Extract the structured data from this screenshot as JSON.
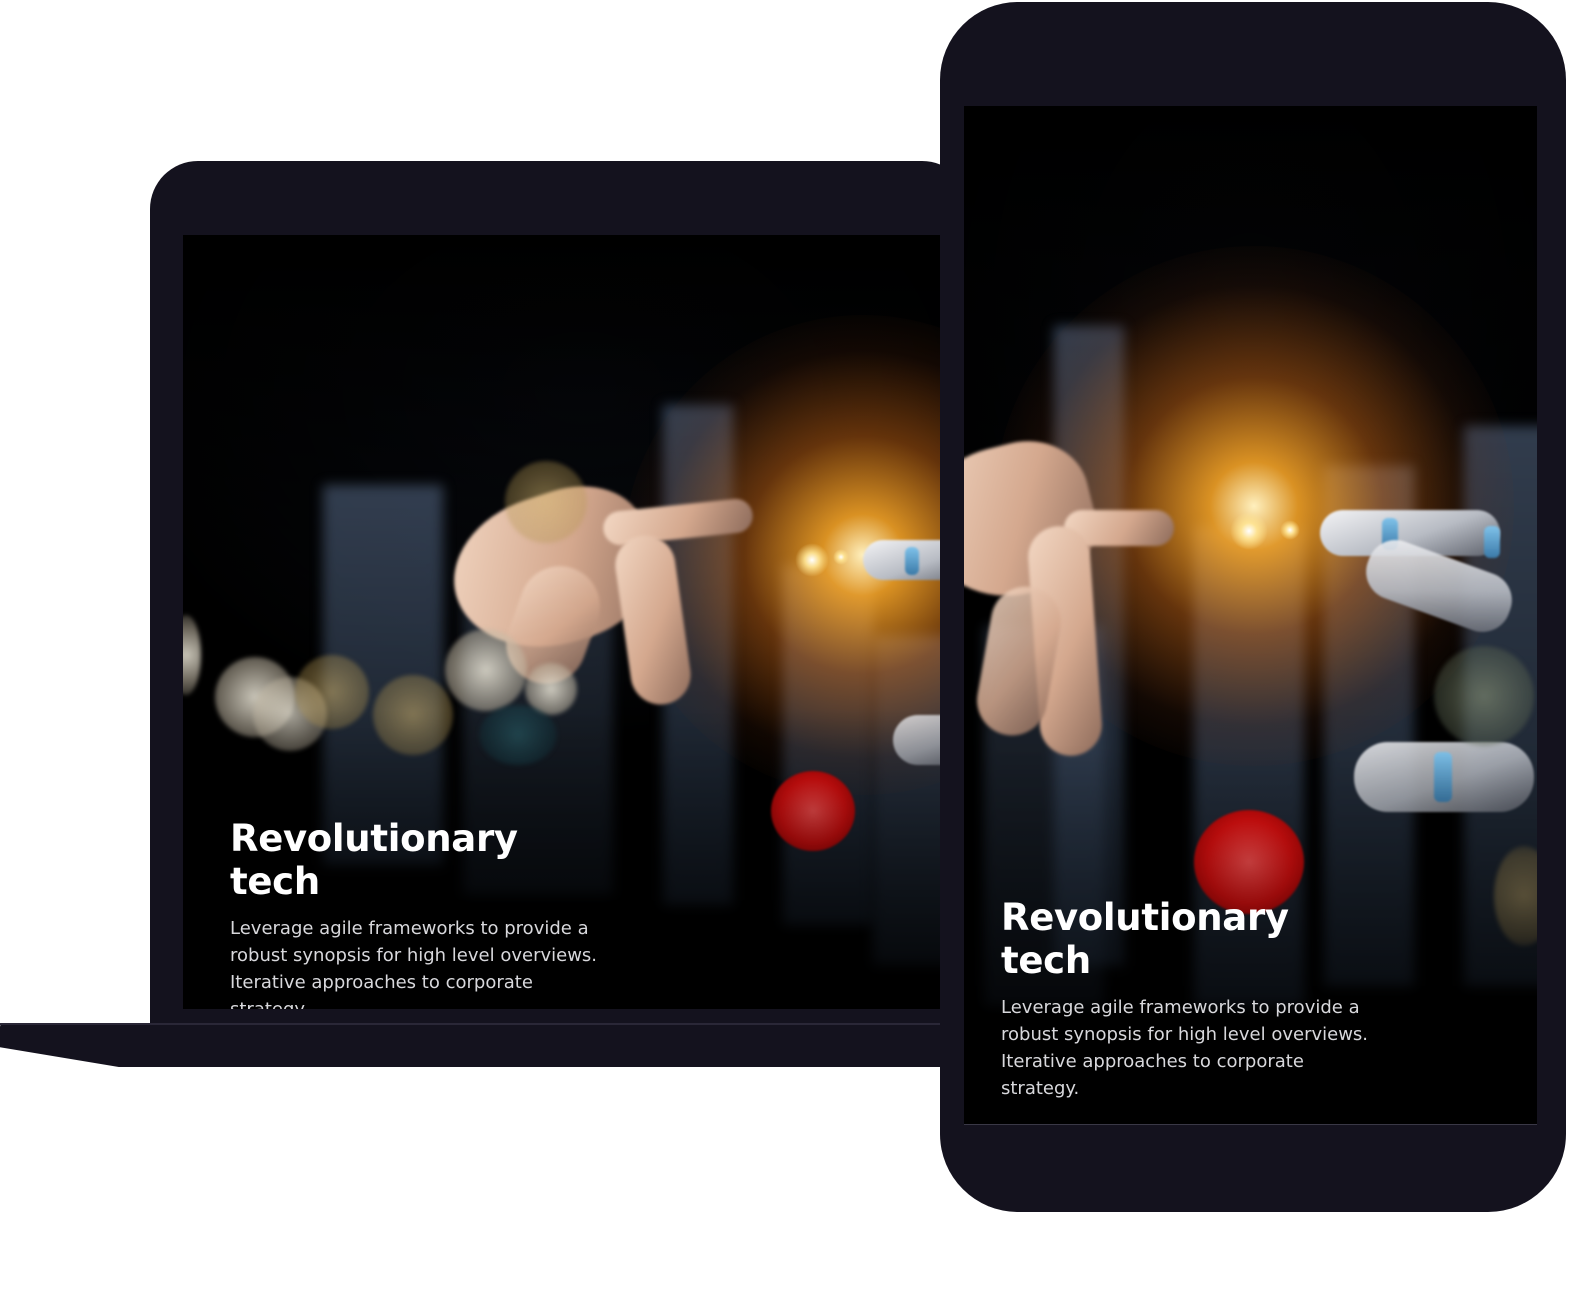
{
  "laptop": {
    "title": "Revolutionary tech",
    "description": "Leverage agile frameworks to provide a robust synopsis for high level overviews. Iterative approaches to corporate strategy."
  },
  "phone": {
    "title": "Revolutionary tech",
    "description": "Leverage agile frameworks to provide a robust synopsis for high level overviews. Iterative approaches to corporate strategy."
  },
  "colors": {
    "device_frame": "#14121e",
    "glow_orange": "#ffaa28",
    "bokeh_red": "#e01010",
    "text_primary": "#ffffff",
    "text_secondary": "#d8d8dc"
  },
  "icons": {
    "hero_image": "hand-robot-touch-image"
  }
}
